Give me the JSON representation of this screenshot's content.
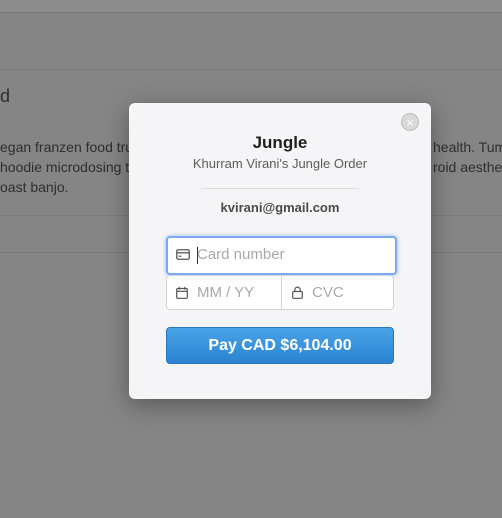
{
  "background": {
    "heading": "d",
    "paragraph_lines": [
      "egan franzen food truck",
      "hoodie microdosing t",
      "oast banjo."
    ],
    "paragraph_tail_lines": [
      "health. Tumb",
      "roid aesthet"
    ]
  },
  "modal": {
    "title": "Jungle",
    "subtitle": "Khurram Virani's Jungle Order",
    "email": "kvirani@gmail.com",
    "close_glyph": "×",
    "card_number": {
      "placeholder": "Card number",
      "value": "",
      "icon": "credit-card-icon"
    },
    "expiry": {
      "placeholder": "MM / YY",
      "icon": "calendar-icon"
    },
    "cvc": {
      "placeholder": "CVC",
      "icon": "lock-icon"
    },
    "pay_button_label": "Pay CAD $6,104.00",
    "colors": {
      "accent": "#2a83d0",
      "focus": "#7aaaf0"
    }
  }
}
